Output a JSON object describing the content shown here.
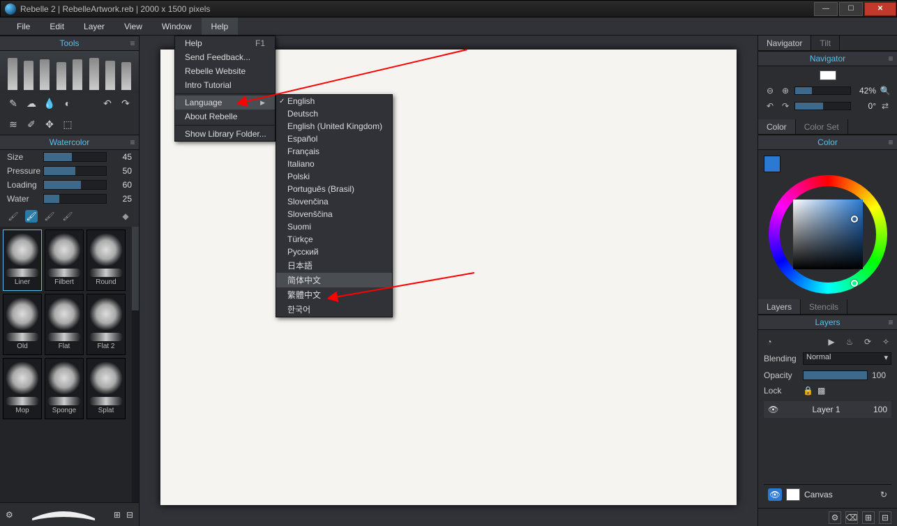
{
  "window": {
    "app": "Rebelle 2",
    "file": "RebelleArtwork.reb",
    "dims": "2000 x 1500 pixels"
  },
  "menubar": [
    "File",
    "Edit",
    "Layer",
    "View",
    "Window",
    "Help"
  ],
  "helpMenu": {
    "help": "Help",
    "helpShortcut": "F1",
    "sendFeedback": "Send Feedback...",
    "website": "Rebelle Website",
    "tutorial": "Intro Tutorial",
    "language": "Language",
    "about": "About Rebelle",
    "showLib": "Show Library Folder..."
  },
  "languages": [
    "English",
    "Deutsch",
    "English (United Kingdom)",
    "Español",
    "Français",
    "Italiano",
    "Polski",
    "Português (Brasil)",
    "Slovenčina",
    "Slovenščina",
    "Suomi",
    "Türkçe",
    "Русский",
    "日本語",
    "简体中文",
    "繁體中文",
    "한국어"
  ],
  "lang_selected_index": 0,
  "lang_highlight_index": 14,
  "toolsPanel": {
    "title": "Tools"
  },
  "brushPanel": {
    "title": "Watercolor",
    "size": {
      "label": "Size",
      "value": 45,
      "pct": 45
    },
    "pressure": {
      "label": "Pressure",
      "value": 50,
      "pct": 50
    },
    "loading": {
      "label": "Loading",
      "value": 60,
      "pct": 60
    },
    "water": {
      "label": "Water",
      "value": 25,
      "pct": 25
    }
  },
  "presets": [
    "Liner",
    "Filbert",
    "Round",
    "Old",
    "Flat",
    "Flat 2",
    "Mop",
    "Sponge",
    "Splat"
  ],
  "navigator": {
    "tab1": "Navigator",
    "tab2": "Tilt",
    "title": "Navigator",
    "zoom": "42%",
    "rotation": "0°"
  },
  "colorPanel": {
    "tab1": "Color",
    "tab2": "Color Set",
    "title": "Color"
  },
  "layersPanel": {
    "tab1": "Layers",
    "tab2": "Stencils",
    "title": "Layers",
    "blendingLabel": "Blending",
    "blendingValue": "Normal",
    "opacityLabel": "Opacity",
    "opacityValue": 100,
    "lockLabel": "Lock",
    "layer1": "Layer 1",
    "layer1op": 100,
    "canvas": "Canvas"
  }
}
